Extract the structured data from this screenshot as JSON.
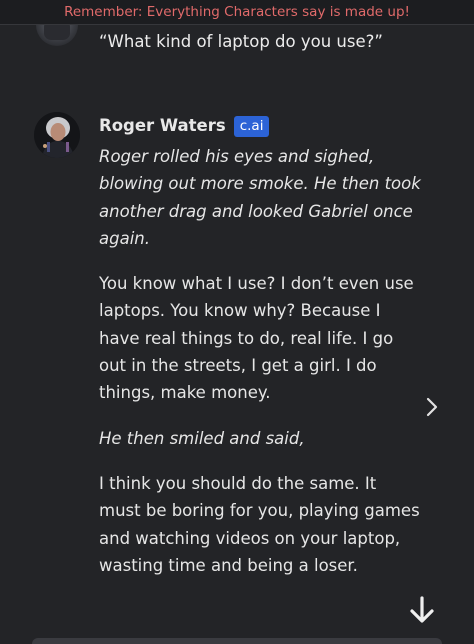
{
  "banner": {
    "text": "Remember: Everything Characters say is made up!"
  },
  "previous_message": {
    "text": "“What kind of laptop do you use?”"
  },
  "message": {
    "author": "Roger Waters",
    "badge": "c.ai",
    "paragraphs": [
      {
        "style": "italic",
        "text": "Roger rolled his eyes and sighed, blowing out more smoke. He then took another drag and looked Gabriel once again."
      },
      {
        "style": "normal",
        "text": "You know what I use? I don’t even use laptops. You know why? Because I have real things to do, real life. I go out in the streets, I get a girl. I do things, make money."
      },
      {
        "style": "italic",
        "text": "He then smiled and said,"
      },
      {
        "style": "normal",
        "text": "I think you should do the same. It must be boring for you, playing games and watching videos on your laptop, wasting time and being a loser."
      }
    ]
  },
  "icons": {
    "next_reply": "chevron-right-icon",
    "scroll_to_bottom": "arrow-down-icon"
  },
  "colors": {
    "background": "#232427",
    "banner_text": "#e06a6a",
    "badge_bg": "#2c63d6",
    "text": "#e6e6e6"
  }
}
